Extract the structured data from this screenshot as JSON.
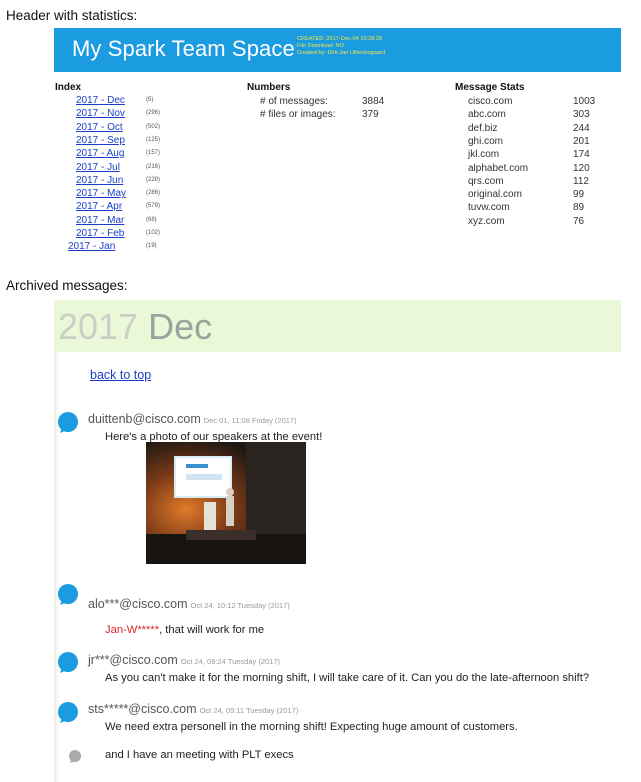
{
  "captions": {
    "header": "Header with statistics:",
    "archived": "Archived messages:"
  },
  "banner": {
    "title": "My Spark Team Space",
    "created": "CREATED: 2017-Dec-04 13:28:28",
    "download": "File Download: NO",
    "created_by": "Created by: Dirk-Jan Uittenbogaard",
    "bg_color": "#1b9be0",
    "meta_color": "#f4e64a"
  },
  "index": {
    "heading": "Index",
    "items": [
      {
        "label": "2017 - Dec",
        "count": "(5)"
      },
      {
        "label": "2017 - Nov",
        "count": "(296)"
      },
      {
        "label": "2017 - Oct",
        "count": "(502)"
      },
      {
        "label": "2017 - Sep",
        "count": "(125)"
      },
      {
        "label": "2017 - Aug",
        "count": "(157)"
      },
      {
        "label": "2017 - Jul",
        "count": "(216)"
      },
      {
        "label": "2017 - Jun",
        "count": "(228)"
      },
      {
        "label": "2017 - May",
        "count": "(286)"
      },
      {
        "label": "2017 - Apr",
        "count": "(579)"
      },
      {
        "label": "2017 - Mar",
        "count": "(68)"
      },
      {
        "label": "2017 - Feb",
        "count": "(102)"
      },
      {
        "label": "2017 - Jan",
        "count": "(19)"
      }
    ]
  },
  "numbers": {
    "heading": "Numbers",
    "rows": [
      {
        "label": "# of messages:",
        "value": "3884"
      },
      {
        "label": "# files or images:",
        "value": "379"
      }
    ]
  },
  "message_stats": {
    "heading": "Message Stats",
    "rows": [
      {
        "domain": "cisco.com",
        "count": "1003"
      },
      {
        "domain": "abc.com",
        "count": "303"
      },
      {
        "domain": "def.biz",
        "count": "244"
      },
      {
        "domain": "ghi.com",
        "count": "201"
      },
      {
        "domain": "jkl.com",
        "count": "174"
      },
      {
        "domain": "alphabet.com",
        "count": "120"
      },
      {
        "domain": "qrs.com",
        "count": "112"
      },
      {
        "domain": "original.com",
        "count": "99"
      },
      {
        "domain": "tuvw.com",
        "count": "89"
      },
      {
        "domain": "xyz.com",
        "count": "76"
      }
    ]
  },
  "archive": {
    "year": "2017",
    "month": "Dec",
    "band_color": "#eaf8d8",
    "back_to_top": "back to top",
    "messages": [
      {
        "sender": "duittenb@cisco.com",
        "stamp": "Dec 01, 11:08 Friday (2017)",
        "text": "Here's a photo of our speakers at the event!"
      },
      {
        "sender": "alo***@cisco.com",
        "stamp": "Oct 24, 10:12 Tuesday (2017)",
        "mention": "Jan-W*****",
        "text": ", that will work for me"
      },
      {
        "sender": "jr***@cisco.com",
        "stamp": "Oct 24, 09:24 Tuesday (2017)",
        "text": "As you can't make it for the morning shift, I will take care of it. Can you do the late-afternoon shift?"
      },
      {
        "sender": "sts*****@cisco.com",
        "stamp": "Oct 24, 09:11 Tuesday (2017)",
        "text": "We need extra personell in the morning shift! Expecting huge amount of customers."
      },
      {
        "text": "and I have an meeting with PLT execs"
      }
    ],
    "bubble_color": "#1b9be0",
    "bubble_small_color": "#aaaaaa",
    "mention_color": "#d8282a"
  }
}
